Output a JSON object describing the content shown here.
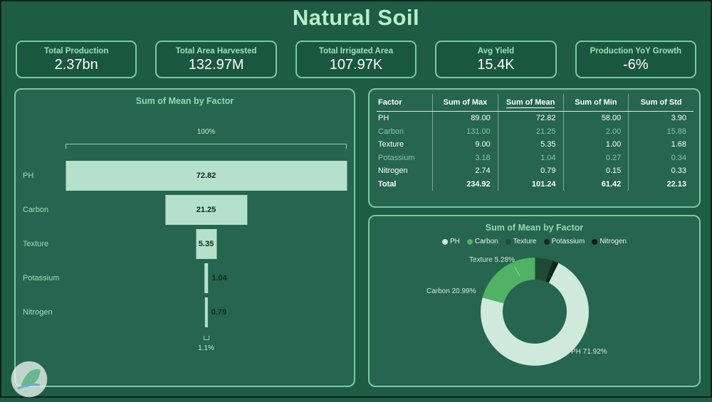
{
  "page": {
    "title": "Natural Soil"
  },
  "theme": {
    "background": "#1e5c46",
    "panel": "#26654f",
    "card": "#1a573f",
    "border": "#79cba1",
    "title_text": "#b9eecb",
    "label_text": "#9fe0bb",
    "bar_fill": "#b5e0ca",
    "bar_label": "#0e2a1e",
    "muted_row_text": "#84c9a4"
  },
  "kpis": [
    {
      "label": "Total Production",
      "value": "2.37bn"
    },
    {
      "label": "Total Area Harvested",
      "value": "132.97M"
    },
    {
      "label": "Total Irrigated Area",
      "value": "107.97K"
    },
    {
      "label": "Avg Yield",
      "value": "15.4K"
    },
    {
      "label": "Production YoY Growth",
      "value": "-6%"
    }
  ],
  "funnel": {
    "title": "Sum of Mean by Factor",
    "top_annotation": "100%",
    "bottom_annotation": "1.1%",
    "rows": [
      {
        "label": "PH",
        "value": 72.82,
        "display": "72.82"
      },
      {
        "label": "Carbon",
        "value": 21.25,
        "display": "21.25"
      },
      {
        "label": "Texture",
        "value": 5.35,
        "display": "5.35"
      },
      {
        "label": "Potassium",
        "value": 1.04,
        "display": "1.04"
      },
      {
        "label": "Nitrogen",
        "value": 0.79,
        "display": "0.79"
      }
    ]
  },
  "table": {
    "columns": [
      {
        "label": "Factor",
        "sorted": false
      },
      {
        "label": "Sum of Max",
        "sorted": false
      },
      {
        "label": "Sum of Mean",
        "sorted": true
      },
      {
        "label": "Sum of Min",
        "sorted": false
      },
      {
        "label": "Sum of Std",
        "sorted": false
      }
    ],
    "rows": [
      {
        "factor": "PH",
        "cells": [
          "89.00",
          "72.82",
          "58.00",
          "3.90"
        ],
        "muted": false
      },
      {
        "factor": "Carbon",
        "cells": [
          "131.00",
          "21.25",
          "2.00",
          "15.88"
        ],
        "muted": true
      },
      {
        "factor": "Texture",
        "cells": [
          "9.00",
          "5.35",
          "1.00",
          "1.68"
        ],
        "muted": false
      },
      {
        "factor": "Potassium",
        "cells": [
          "3.18",
          "1.04",
          "0.27",
          "0.34"
        ],
        "muted": true
      },
      {
        "factor": "Nitrogen",
        "cells": [
          "2.74",
          "0.79",
          "0.15",
          "0.33"
        ],
        "muted": false
      }
    ],
    "total": {
      "factor": "Total",
      "cells": [
        "234.92",
        "101.24",
        "61.42",
        "22.13"
      ]
    }
  },
  "donut": {
    "title": "Sum of Mean by Factor",
    "start_angle": 26,
    "segments": [
      {
        "name": "PH",
        "pct": 71.92,
        "color": "#cfeadb"
      },
      {
        "name": "Carbon",
        "pct": 20.99,
        "color": "#4fb264"
      },
      {
        "name": "Texture",
        "pct": 5.28,
        "color": "#1f4a36"
      },
      {
        "name": "Potassium",
        "pct": 1.03,
        "color": "#102b1f"
      },
      {
        "name": "Nitrogen",
        "pct": 0.78,
        "color": "#0b1f15"
      }
    ],
    "callouts": [
      "Texture 5.28%",
      "Carbon 20.99%",
      "PH 71.92%"
    ]
  },
  "chart_data": [
    {
      "type": "bar",
      "subtype": "funnel",
      "title": "Sum of Mean by Factor",
      "categories": [
        "PH",
        "Carbon",
        "Texture",
        "Potassium",
        "Nitrogen"
      ],
      "values": [
        72.82,
        21.25,
        5.35,
        1.04,
        0.79
      ],
      "annotations": [
        "100%",
        "1.1%"
      ],
      "orientation": "horizontal-centered"
    },
    {
      "type": "table",
      "title": "Factor statistics",
      "columns": [
        "Factor",
        "Sum of Max",
        "Sum of Mean",
        "Sum of Min",
        "Sum of Std"
      ],
      "rows": [
        [
          "PH",
          89.0,
          72.82,
          58.0,
          3.9
        ],
        [
          "Carbon",
          131.0,
          21.25,
          2.0,
          15.88
        ],
        [
          "Texture",
          9.0,
          5.35,
          1.0,
          1.68
        ],
        [
          "Potassium",
          3.18,
          1.04,
          0.27,
          0.34
        ],
        [
          "Nitrogen",
          2.74,
          0.79,
          0.15,
          0.33
        ],
        [
          "Total",
          234.92,
          101.24,
          61.42,
          22.13
        ]
      ],
      "sorted_column": "Sum of Mean"
    },
    {
      "type": "pie",
      "subtype": "donut",
      "title": "Sum of Mean by Factor",
      "labels": [
        "PH",
        "Carbon",
        "Texture",
        "Potassium",
        "Nitrogen"
      ],
      "values": [
        71.92,
        20.99,
        5.28,
        1.03,
        0.78
      ],
      "unit": "%",
      "legend_position": "top",
      "colors": [
        "#cfeadb",
        "#4fb264",
        "#1f4a36",
        "#102b1f",
        "#0b1f15"
      ]
    }
  ]
}
